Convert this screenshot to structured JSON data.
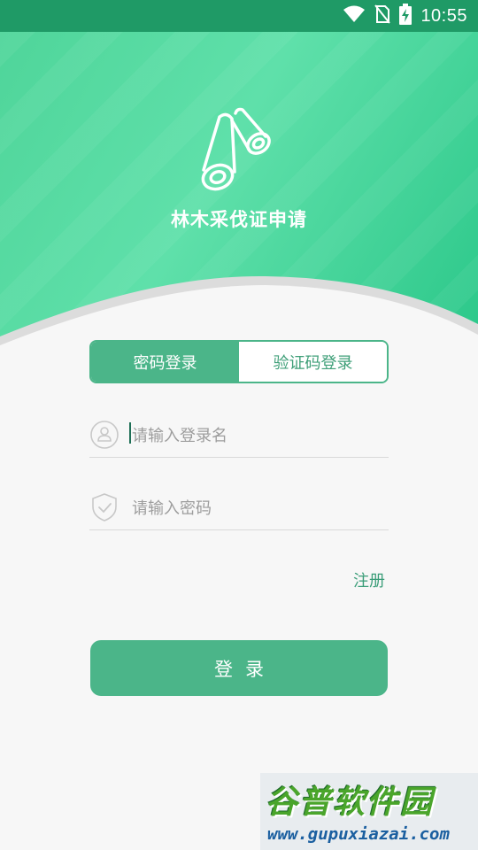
{
  "status_bar": {
    "time": "10:55",
    "icons": [
      "wifi-icon",
      "no-sim-icon",
      "battery-charging-icon"
    ]
  },
  "hero": {
    "app_title": "林木采伐证申请",
    "logo_icon": "logs-icon"
  },
  "tabs": [
    {
      "label": "密码登录",
      "active": true
    },
    {
      "label": "验证码登录",
      "active": false
    }
  ],
  "form": {
    "username_placeholder": "请输入登录名",
    "password_placeholder": "请输入密码",
    "username_icon": "user-icon",
    "password_icon": "shield-check-icon"
  },
  "register_label": "注册",
  "login_label": "登录",
  "watermark": {
    "title": "谷普软件园",
    "url": "www.gupuxiazai.com"
  },
  "colors": {
    "primary": "#4bb589",
    "status_bar": "#1f9a66",
    "hero_gradient_start": "#4fd59a",
    "hero_gradient_end": "#2cc88a"
  }
}
